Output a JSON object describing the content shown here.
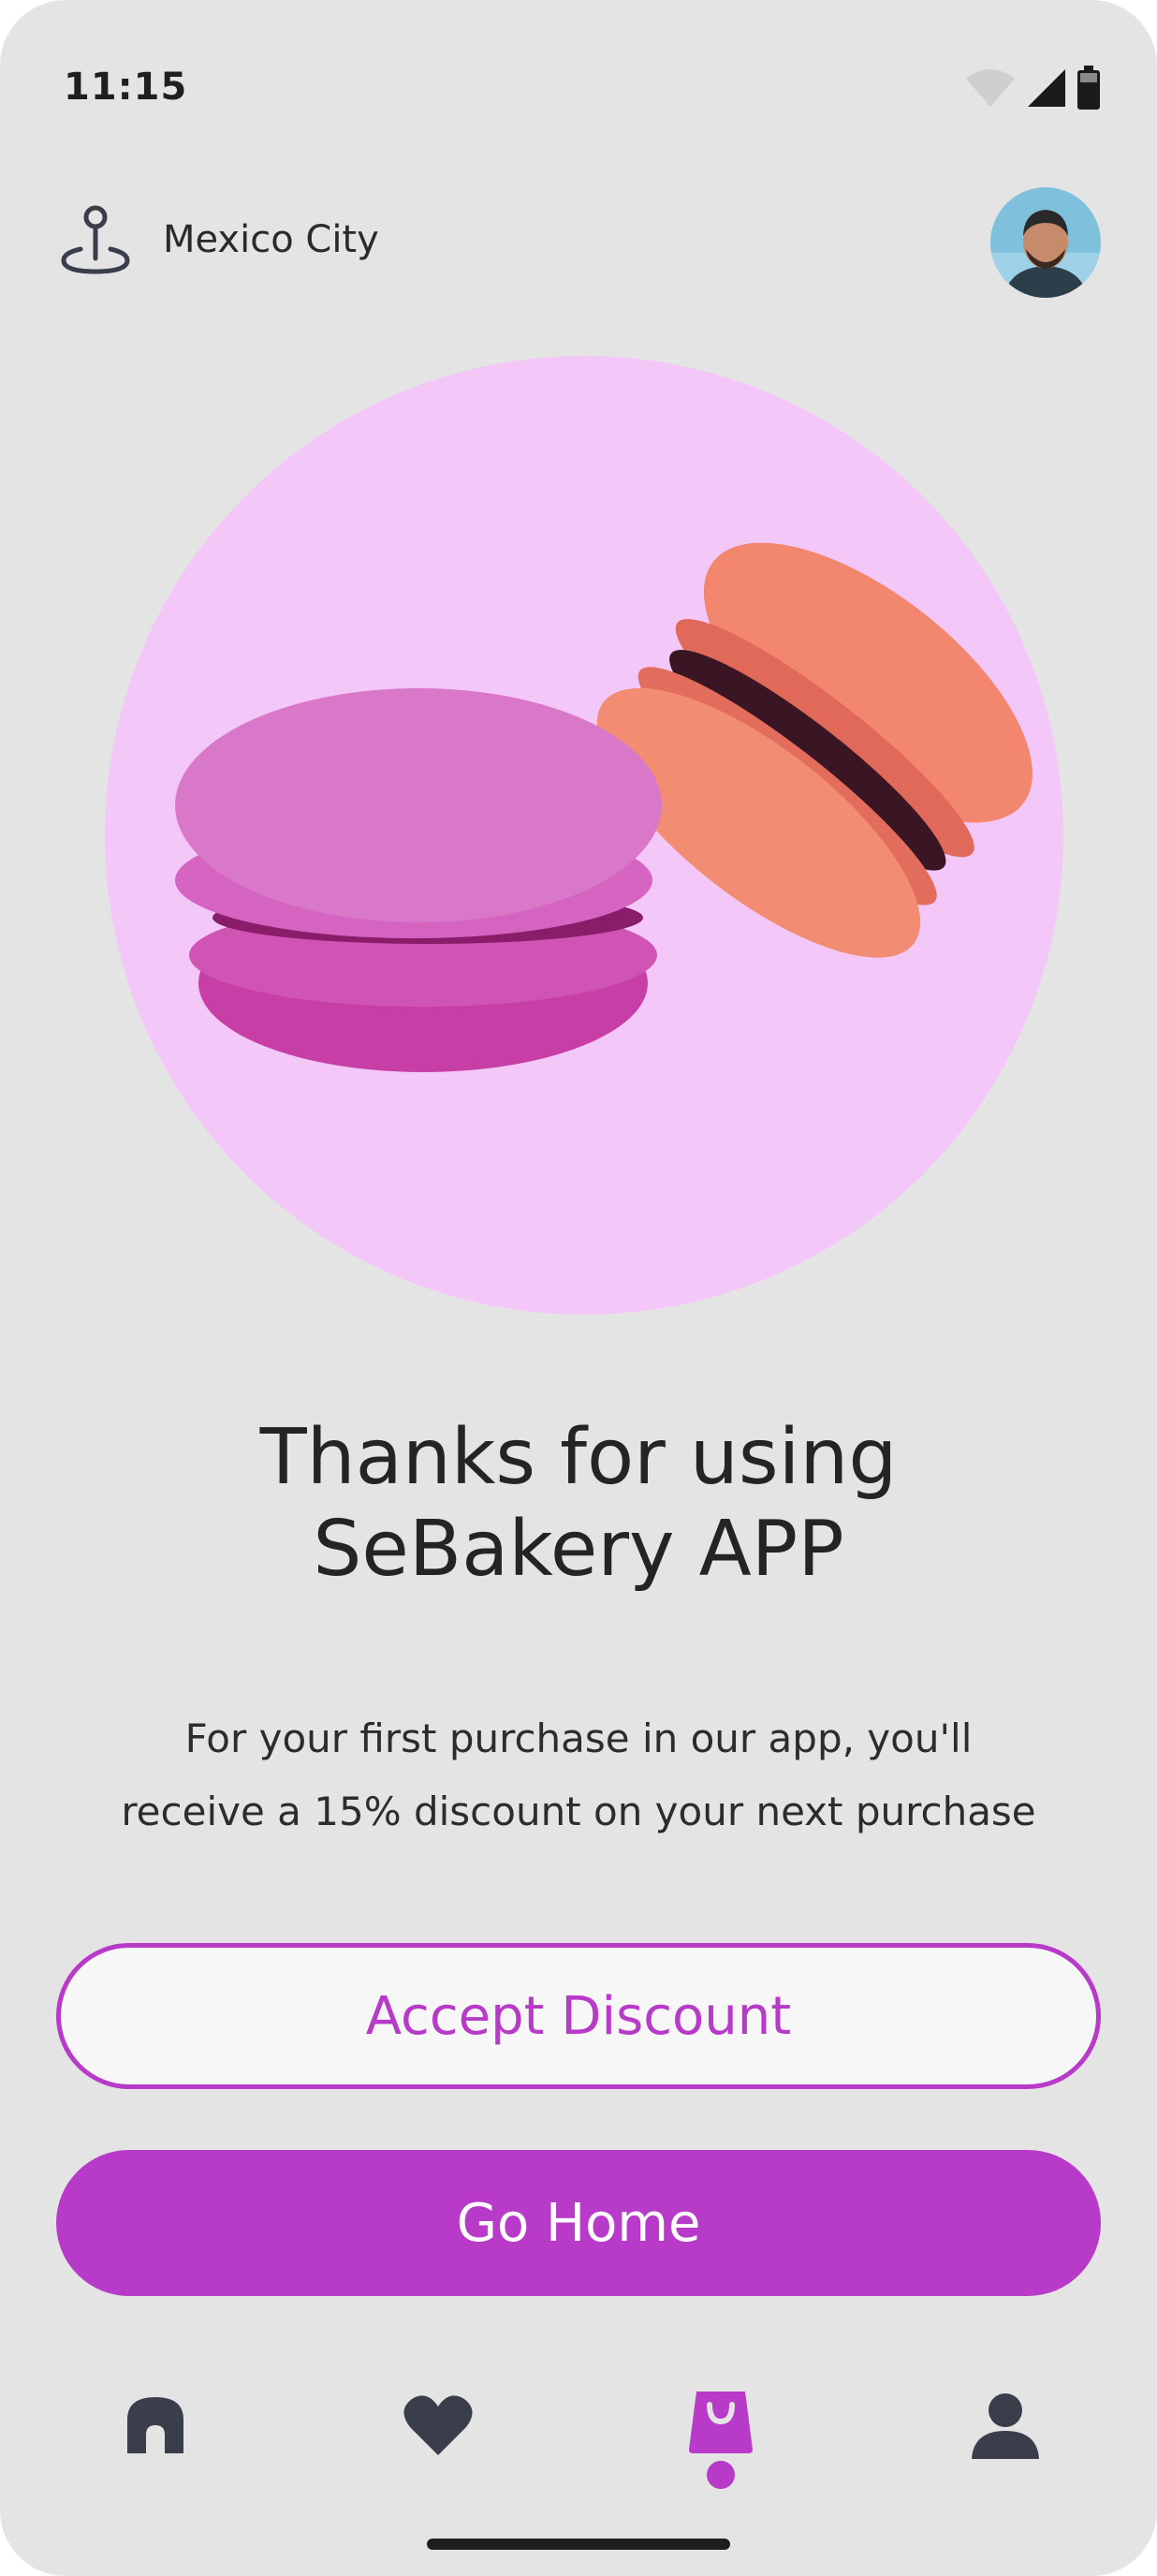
{
  "status_bar": {
    "time": "11:15"
  },
  "header": {
    "location": "Mexico City",
    "location_icon": "map-pin-icon",
    "avatar": "user-avatar"
  },
  "main": {
    "title_line1": "Thanks for using",
    "title_line2": "SeBakery APP",
    "desc_line1": "For your first purchase in our app, you'll",
    "desc_line2": "receive a 15% discount on your next purchase"
  },
  "buttons": {
    "accept": "Accept Discount",
    "home": "Go Home"
  },
  "bottom_nav": {
    "items": [
      "home-icon",
      "heart-icon",
      "shopping-bag-icon",
      "profile-icon"
    ],
    "active": "shopping-bag-icon"
  },
  "colors": {
    "accent": "#b73ac8",
    "hero_bg": "#f3c8f8",
    "screen_bg": "#e5e4e5",
    "icon": "#3a3d4a"
  }
}
